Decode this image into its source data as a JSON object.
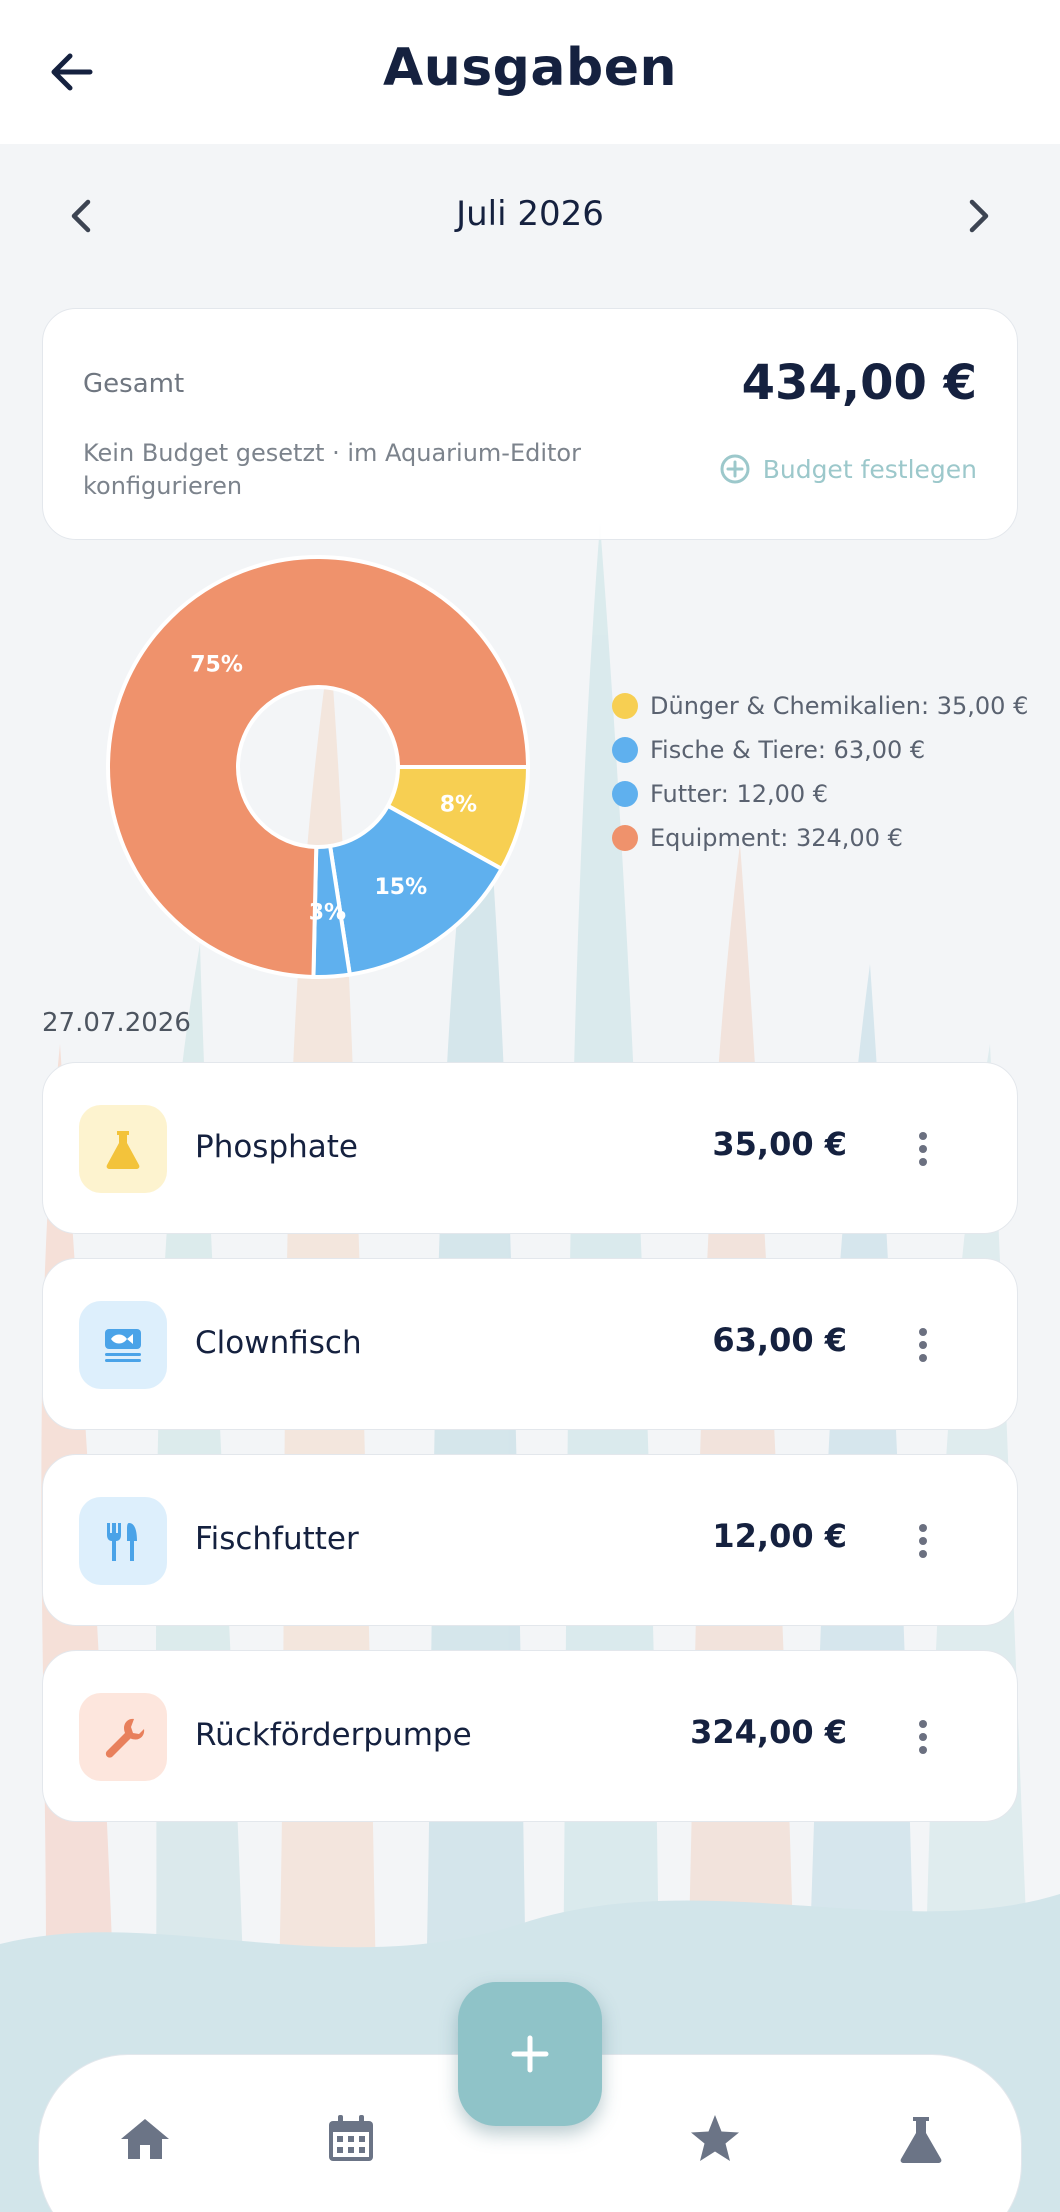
{
  "header": {
    "title": "Ausgaben",
    "back_icon": "arrow-left-icon"
  },
  "month_nav": {
    "label": "Juli 2026",
    "prev_icon": "chevron-left-icon",
    "next_icon": "chevron-right-icon"
  },
  "summary": {
    "total_label": "Gesamt",
    "total_amount": "434,00 €",
    "budget_note": "Kein Budget gesetzt · im Aquarium-Editor konfigurieren",
    "budget_button_label": "Budget festlegen",
    "budget_button_icon": "add-circle-icon",
    "budget_button_color": "#9cc8cb"
  },
  "chart_data": {
    "type": "pie",
    "slices": [
      {
        "label": "Dünger & Chemikalien",
        "value": 35.0,
        "percent_label": "8%",
        "color": "#f7cf52"
      },
      {
        "label": "Fische & Tiere",
        "value": 63.0,
        "percent_label": "15%",
        "color": "#5fb0ee"
      },
      {
        "label": "Futter",
        "value": 12.0,
        "percent_label": "3%",
        "color": "#5fb0ee"
      },
      {
        "label": "Equipment",
        "value": 324.0,
        "percent_label": "75%",
        "color": "#ef926c"
      }
    ],
    "legend_placement": "right"
  },
  "legend": [
    {
      "text": "Dünger & Chemikalien: 35,00 €",
      "color": "#f7cf52"
    },
    {
      "text": "Fische & Tiere: 63,00 €",
      "color": "#5fb0ee"
    },
    {
      "text": "Futter: 12,00 €",
      "color": "#5fb0ee"
    },
    {
      "text": "Equipment: 324,00 €",
      "color": "#ef926c"
    }
  ],
  "date_heading": "27.07.2026",
  "expenses": [
    {
      "name": "Phosphate",
      "amount": "35,00 €",
      "icon": "flask-icon",
      "icon_bg": "#fdf3cf",
      "icon_color": "#f3c33b"
    },
    {
      "name": "Clownfisch",
      "amount": "63,00 €",
      "icon": "fish-icon",
      "icon_bg": "#ddeffc",
      "icon_color": "#4aa3e8"
    },
    {
      "name": "Fischfutter",
      "amount": "12,00 €",
      "icon": "cutlery-icon",
      "icon_bg": "#ddeffc",
      "icon_color": "#4aa3e8"
    },
    {
      "name": "Rückförderpumpe",
      "amount": "324,00 €",
      "icon": "wrench-icon",
      "icon_bg": "#fde6dd",
      "icon_color": "#e8805c"
    }
  ],
  "bottom_nav": {
    "items": [
      "home-icon",
      "calendar-icon",
      "star-icon",
      "flask-icon"
    ],
    "fab_icon": "plus-icon",
    "fab_color": "#8fc3c8"
  }
}
